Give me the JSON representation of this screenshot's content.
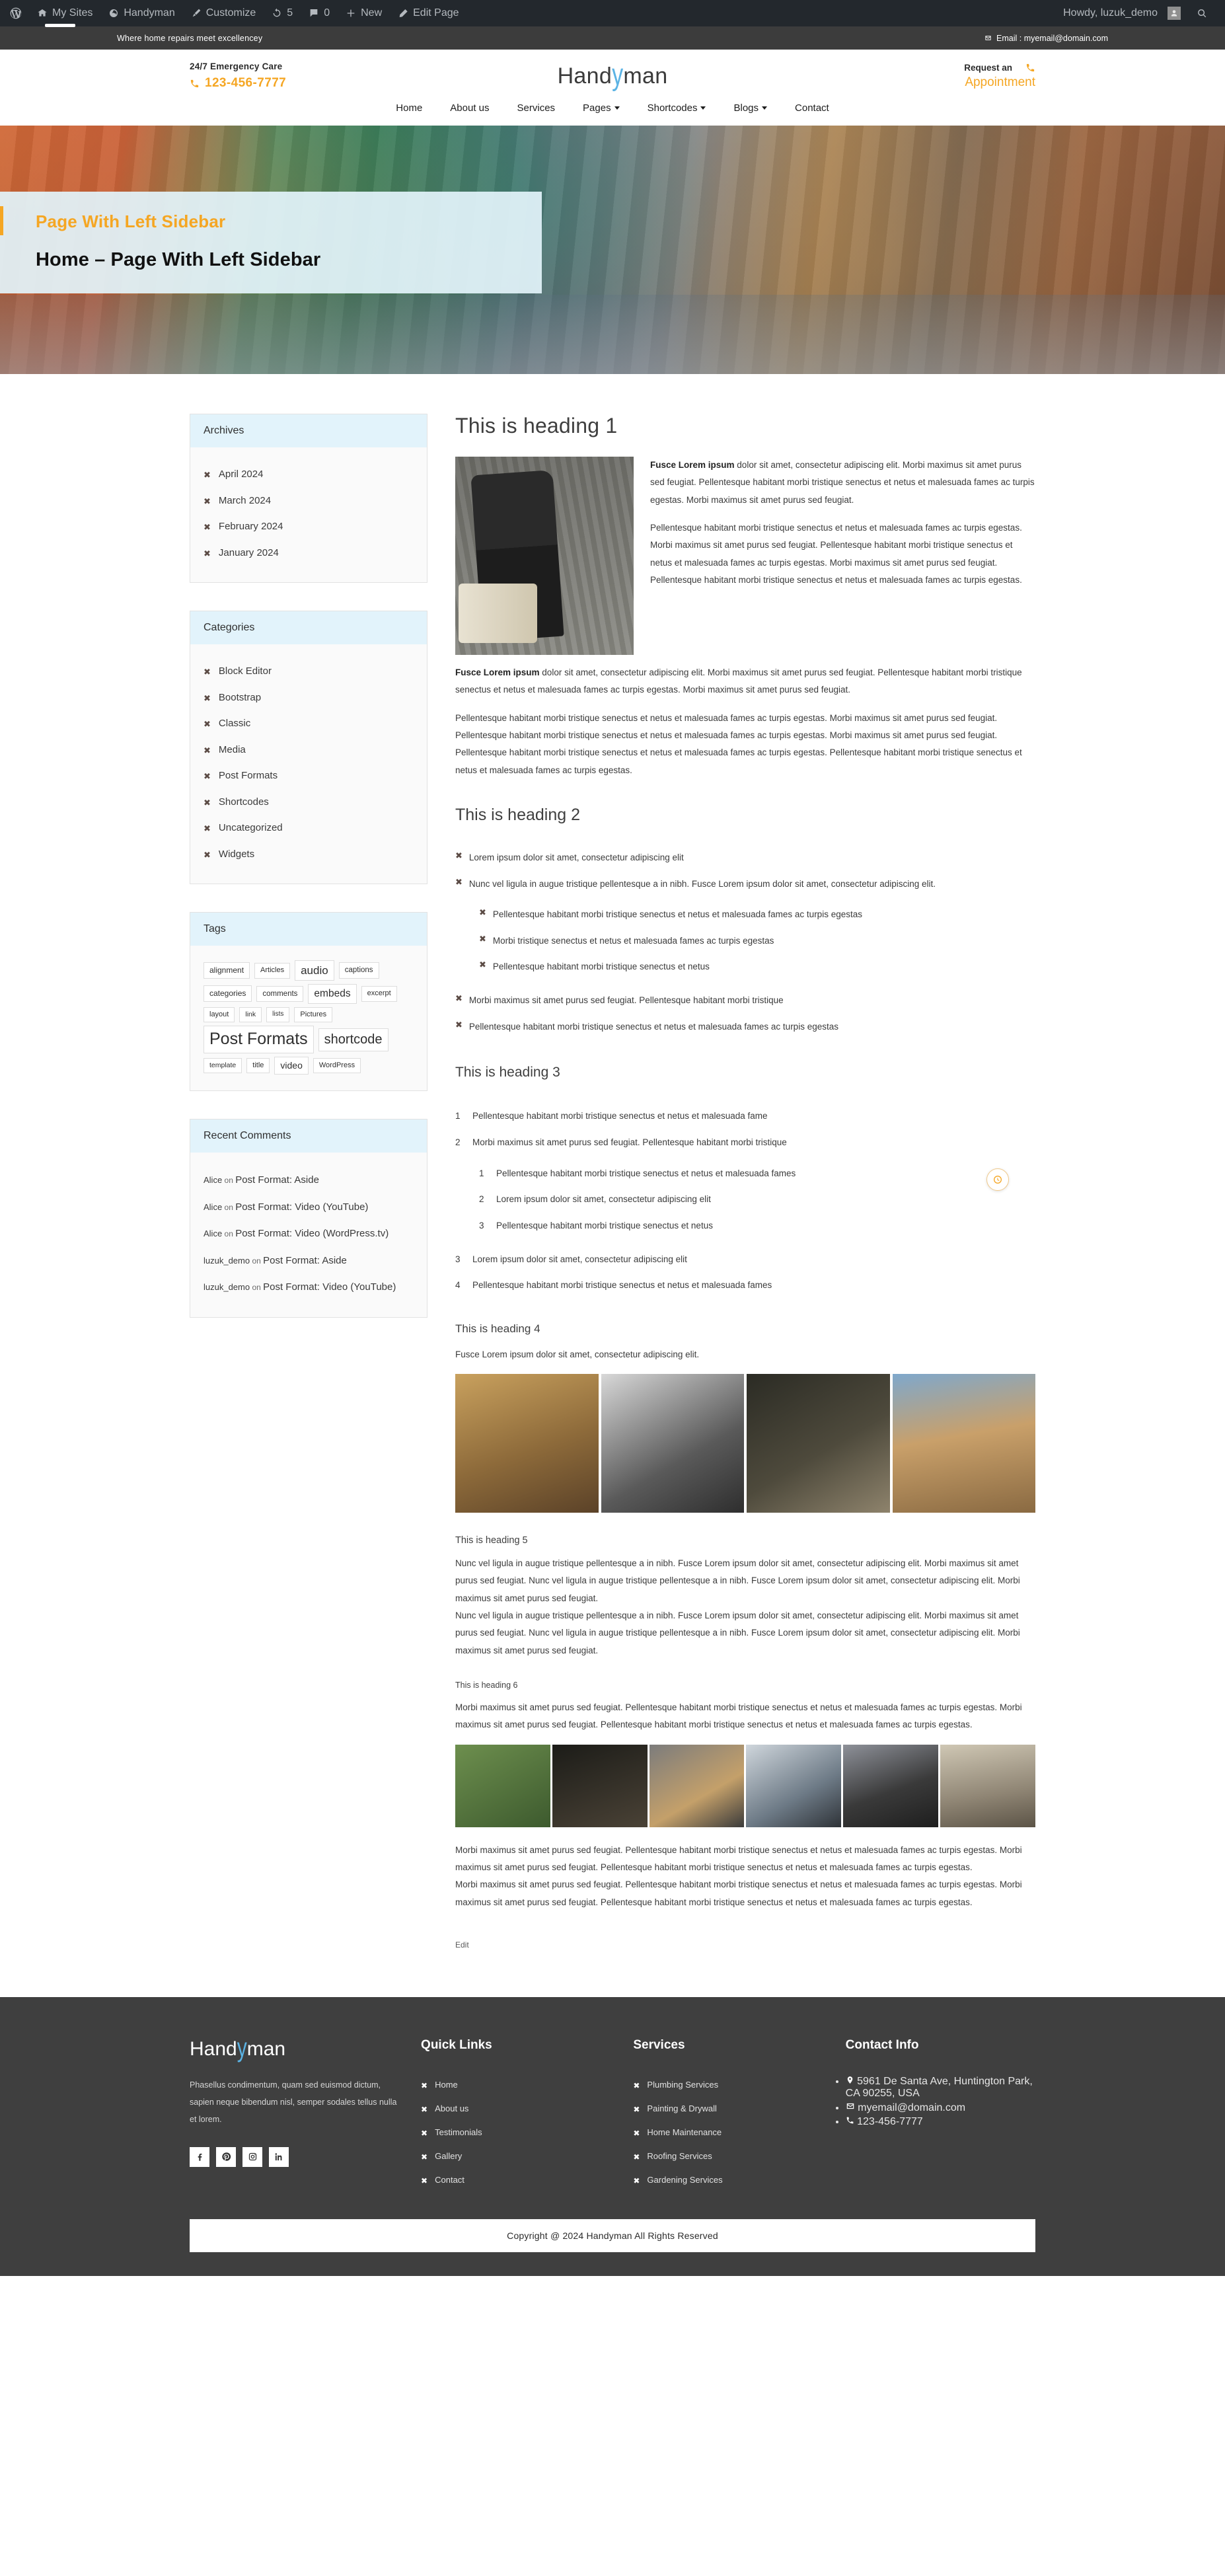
{
  "admin_bar": {
    "items": [
      {
        "icon": "wordpress-logo-icon",
        "label": ""
      },
      {
        "icon": "sites-icon",
        "label": "My Sites"
      },
      {
        "icon": "dashboard-icon",
        "label": "Handyman"
      },
      {
        "icon": "brush-icon",
        "label": "Customize"
      },
      {
        "icon": "updates-icon",
        "label": "5"
      },
      {
        "icon": "comment-icon",
        "label": "0"
      },
      {
        "icon": "plus-icon",
        "label": "New"
      },
      {
        "icon": "pencil-icon",
        "label": "Edit Page"
      }
    ],
    "greeting": "Howdy, luzuk_demo",
    "search_icon": "search-icon"
  },
  "topbar": {
    "tagline": "Where home repairs meet excellencey",
    "email_icon": "envelope-icon",
    "email": "Email : myemail@domain.com"
  },
  "header": {
    "emergency_label": "24/7 Emergency Care",
    "phone_icon": "phone-icon",
    "phone": "123-456-7777",
    "logo_part1": "Hand",
    "logo_swoosh": "y",
    "logo_part2": "man",
    "request_label": "Request an",
    "request_icon": "phone-icon",
    "appointment": "Appointment"
  },
  "nav": {
    "items": [
      {
        "label": "Home",
        "has_caret": false
      },
      {
        "label": "About us",
        "has_caret": false
      },
      {
        "label": "Services",
        "has_caret": false
      },
      {
        "label": "Pages",
        "has_caret": true
      },
      {
        "label": "Shortcodes",
        "has_caret": true
      },
      {
        "label": "Blogs",
        "has_caret": true
      },
      {
        "label": "Contact",
        "has_caret": false
      }
    ]
  },
  "hero": {
    "subtitle": "Page With Left Sidebar",
    "title": "Home – Page With Left Sidebar"
  },
  "sidebar": {
    "archives": {
      "title": "Archives",
      "items": [
        "April 2024",
        "March 2024",
        "February 2024",
        "January 2024"
      ]
    },
    "categories": {
      "title": "Categories",
      "items": [
        "Block Editor",
        "Bootstrap",
        "Classic",
        "Media",
        "Post Formats",
        "Shortcodes",
        "Uncategorized",
        "Widgets"
      ]
    },
    "tags": {
      "title": "Tags",
      "items": [
        {
          "label": "alignment",
          "size": 12
        },
        {
          "label": "Articles",
          "size": 11
        },
        {
          "label": "audio",
          "size": 17
        },
        {
          "label": "captions",
          "size": 11.5
        },
        {
          "label": "categories",
          "size": 12
        },
        {
          "label": "comments",
          "size": 11.5
        },
        {
          "label": "embeds",
          "size": 15.5
        },
        {
          "label": "excerpt",
          "size": 11
        },
        {
          "label": "layout",
          "size": 11
        },
        {
          "label": "link",
          "size": 10.5
        },
        {
          "label": "lists",
          "size": 10
        },
        {
          "label": "Pictures",
          "size": 11
        },
        {
          "label": "Post Formats",
          "size": 25
        },
        {
          "label": "shortcode",
          "size": 20
        },
        {
          "label": "template",
          "size": 10.5
        },
        {
          "label": "title",
          "size": 11
        },
        {
          "label": "video",
          "size": 14
        },
        {
          "label": "WordPress",
          "size": 11
        }
      ]
    },
    "recent_comments": {
      "title": "Recent Comments",
      "items": [
        {
          "author": "Alice",
          "on": "on",
          "post": "Post Format: Aside"
        },
        {
          "author": "Alice",
          "on": "on",
          "post": "Post Format: Video (YouTube)"
        },
        {
          "author": "Alice",
          "on": "on",
          "post": "Post Format: Video (WordPress.tv)"
        },
        {
          "author": "luzuk_demo",
          "on": "on",
          "post": "Post Format: Aside"
        },
        {
          "author": "luzuk_demo",
          "on": "on",
          "post": "Post Format: Video (YouTube)"
        }
      ]
    }
  },
  "content": {
    "h1": "This is heading 1",
    "p1_bold": "Fusce Lorem ipsum",
    "p1_rest": " dolor sit amet, consectetur adipiscing elit. Morbi maximus sit amet purus sed feugiat. Pellentesque habitant morbi tristique senectus et netus et malesuada fames ac turpis egestas. Morbi maximus sit amet purus sed feugiat.",
    "p2": "Pellentesque habitant morbi tristique senectus et netus et malesuada fames ac turpis egestas. Morbi maximus sit amet purus sed feugiat. Pellentesque habitant morbi tristique senectus et netus et malesuada fames ac turpis egestas. Morbi maximus sit amet purus sed feugiat. Pellentesque habitant morbi tristique senectus et netus et malesuada fames ac turpis egestas.",
    "p3_bold": "Fusce Lorem ipsum",
    "p3_rest": " dolor sit amet, consectetur adipiscing elit. Morbi maximus sit amet purus sed feugiat. Pellentesque habitant morbi tristique senectus et netus et malesuada fames ac turpis egestas. Morbi maximus sit amet purus sed feugiat.",
    "p4": "Pellentesque habitant morbi tristique senectus et netus et malesuada fames ac turpis egestas. Morbi maximus sit amet purus sed feugiat. Pellentesque habitant morbi tristique senectus et netus et malesuada fames ac turpis egestas. Morbi maximus sit amet purus sed feugiat. Pellentesque habitant morbi tristique senectus et netus et malesuada fames ac turpis egestas. Pellentesque habitant morbi tristique senectus et netus et malesuada fames ac turpis egestas.",
    "h2": "This is heading 2",
    "ul": [
      "Lorem ipsum dolor sit amet, consectetur adipiscing elit",
      "Nunc vel ligula in augue tristique pellentesque a in nibh. Fusce Lorem ipsum dolor sit amet, consectetur adipiscing elit.",
      "Morbi maximus sit amet purus sed feugiat. Pellentesque habitant morbi tristique",
      "Pellentesque habitant morbi tristique senectus et netus et malesuada fames ac turpis egestas"
    ],
    "ul_nested": [
      "Pellentesque habitant morbi tristique senectus et netus et malesuada fames ac turpis egestas",
      "Morbi tristique senectus et netus et malesuada fames ac turpis egestas",
      "Pellentesque habitant morbi tristique senectus et netus"
    ],
    "h3": "This is heading 3",
    "ol": [
      "Pellentesque habitant morbi tristique senectus et netus et malesuada fame",
      "Morbi maximus sit amet purus sed feugiat. Pellentesque habitant morbi tristique",
      "Lorem ipsum dolor sit amet, consectetur adipiscing elit",
      "Pellentesque habitant morbi tristique senectus et netus et malesuada fames"
    ],
    "ol_nested": [
      "Pellentesque habitant morbi tristique senectus et netus et malesuada fames",
      "Lorem ipsum dolor sit amet, consectetur adipiscing elit",
      "Pellentesque habitant morbi tristique senectus et netus"
    ],
    "h4": "This is heading 4",
    "p_h4": "Fusce Lorem ipsum dolor sit amet, consectetur adipiscing elit.",
    "h5": "This is heading 5",
    "p_h5_a": "Nunc vel ligula in augue tristique pellentesque a in nibh. Fusce Lorem ipsum dolor sit amet, consectetur adipiscing elit. Morbi maximus sit amet purus sed feugiat. Nunc vel ligula in augue tristique pellentesque a in nibh. Fusce Lorem ipsum dolor sit amet, consectetur adipiscing elit. Morbi maximus sit amet purus sed feugiat.",
    "p_h5_b": "Nunc vel ligula in augue tristique pellentesque a in nibh. Fusce Lorem ipsum dolor sit amet, consectetur adipiscing elit. Morbi maximus sit amet purus sed feugiat. Nunc vel ligula in augue tristique pellentesque a in nibh. Fusce Lorem ipsum dolor sit amet, consectetur adipiscing elit. Morbi maximus sit amet purus sed feugiat.",
    "h6": "This is heading 6",
    "p_h6": "Morbi maximus sit amet purus sed feugiat. Pellentesque habitant morbi tristique senectus et netus et malesuada fames ac turpis egestas. Morbi maximus sit amet purus sed feugiat. Pellentesque habitant morbi tristique senectus et netus et malesuada fames ac turpis egestas.",
    "p_h6_after_a": "Morbi maximus sit amet purus sed feugiat. Pellentesque habitant morbi tristique senectus et netus et malesuada fames ac turpis egestas. Morbi maximus sit amet purus sed feugiat. Pellentesque habitant morbi tristique senectus et netus et malesuada fames ac turpis egestas.",
    "p_h6_after_b": "Morbi maximus sit amet purus sed feugiat. Pellentesque habitant morbi tristique senectus et netus et malesuada fames ac turpis egestas. Morbi maximus sit amet purus sed feugiat. Pellentesque habitant morbi tristique senectus et netus et malesuada fames ac turpis egestas.",
    "edit": "Edit"
  },
  "footer": {
    "logo_part1": "Hand",
    "logo_swoosh": "y",
    "logo_part2": "man",
    "about": "Phasellus condimentum, quam sed euismod dictum, sapien neque bibendum nisl, semper sodales tellus nulla et lorem.",
    "social": [
      "facebook-icon",
      "pinterest-icon",
      "instagram-icon",
      "linkedin-icon"
    ],
    "quick_links": {
      "title": "Quick Links",
      "items": [
        "Home",
        "About us",
        "Testimonials",
        "Gallery",
        "Contact"
      ]
    },
    "services": {
      "title": "Services",
      "items": [
        "Plumbing Services",
        "Painting & Drywall",
        "Home Maintenance",
        "Roofing Services",
        "Gardening Services"
      ]
    },
    "contact": {
      "title": "Contact Info",
      "address": "5961 De Santa Ave, Huntington Park, CA 90255, USA",
      "email": "myemail@domain.com",
      "phone": "123-456-7777"
    },
    "copyright": "Copyright @ 2024 Handyman All Rights Reserved"
  },
  "colors": {
    "accent": "#f5a623",
    "sky": "#5bb3e4",
    "widget_head": "#e2f3fb",
    "footer_bg": "#3f3f3f",
    "admin_bar": "#23282d"
  }
}
